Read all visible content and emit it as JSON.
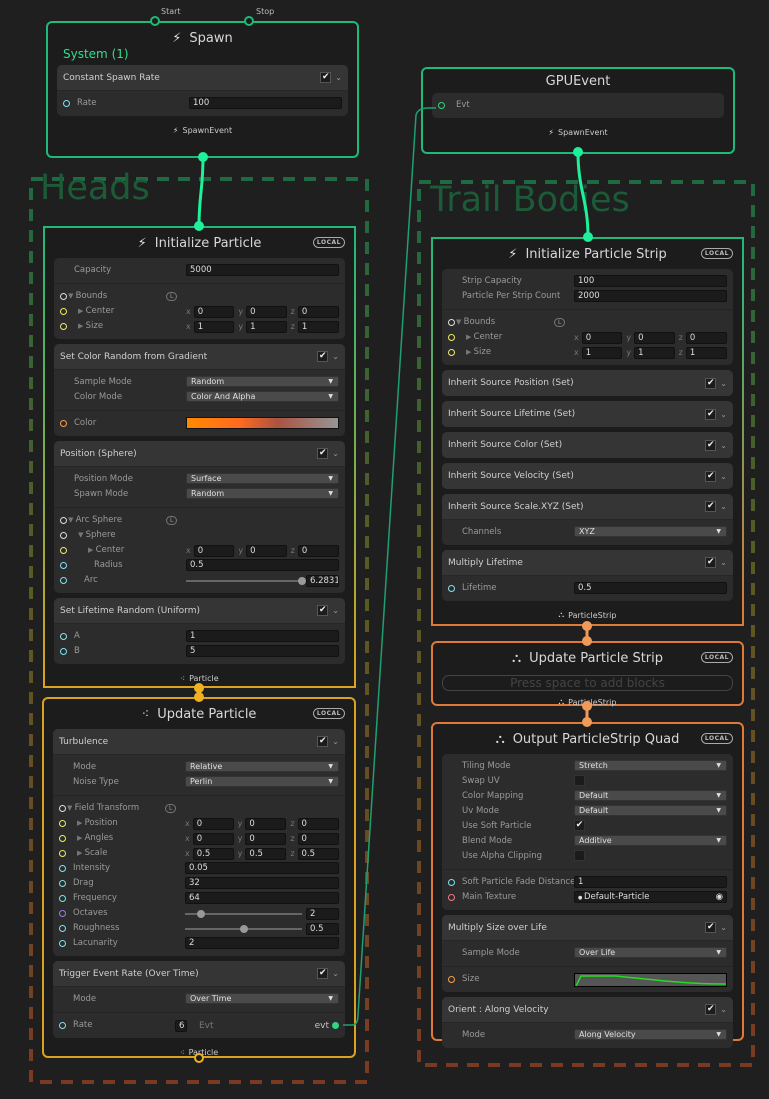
{
  "colors": {
    "spawn": "#1fb97a",
    "particle": "#d9a21f",
    "strip": "#dd7a3a",
    "float": "#7fe3f0",
    "vector": "#f0ea6a",
    "bounds": "#dddddd",
    "gradient": "#f4a050",
    "texture": "#f07a8a",
    "uint": "#9a7cf0",
    "event": "#2fd67f",
    "group_heads_top": "#1e6a42",
    "group_heads_bottom": "#7a3a22",
    "curve": "#22dd22"
  },
  "groups": [
    {
      "title": "Heads"
    },
    {
      "title": "Trail Bodies"
    }
  ],
  "spawn_ports": {
    "start": "Start",
    "stop": "Stop"
  },
  "nodes": {
    "spawn": {
      "title": "Spawn",
      "icon": "lightning-icon",
      "system": "System (1)",
      "blocks": [
        {
          "title": "Constant Spawn Rate",
          "enabled": true,
          "sections": [
            [
              {
                "type": "field",
                "label": "Rate",
                "value": "100",
                "port": "float"
              }
            ]
          ]
        }
      ],
      "footer": {
        "label": "SpawnEvent",
        "icon": "lightning-icon"
      }
    },
    "gpu_event": {
      "title": "GPUEvent",
      "blocks": [
        {
          "sections": [
            [
              {
                "type": "evt_in",
                "label": "Evt",
                "port": "event"
              }
            ]
          ]
        }
      ],
      "footer": {
        "label": "SpawnEvent",
        "icon": "lightning-icon"
      }
    },
    "init_particle": {
      "title": "Initialize Particle",
      "icon": "lightning-icon",
      "badge": "LOCAL",
      "blocks": [
        {
          "sections": [
            [
              {
                "type": "field",
                "label": "Capacity",
                "value": "5000"
              }
            ],
            [
              {
                "type": "group",
                "label": "Bounds",
                "port": "bounds",
                "space": "L"
              },
              {
                "type": "vec3",
                "label": "Center",
                "port": "vector",
                "indent": 1,
                "x": "0",
                "y": "0",
                "z": "0"
              },
              {
                "type": "vec3",
                "label": "Size",
                "port": "vector",
                "indent": 1,
                "x": "1",
                "y": "1",
                "z": "1"
              }
            ]
          ]
        },
        {
          "title": "Set Color Random from Gradient",
          "enabled": true,
          "sections": [
            [
              {
                "type": "dropdown",
                "label": "Sample Mode",
                "value": "Random"
              },
              {
                "type": "dropdown",
                "label": "Color Mode",
                "value": "Color And Alpha"
              }
            ],
            [
              {
                "type": "gradient",
                "label": "Color",
                "port": "gradient"
              }
            ]
          ]
        },
        {
          "title": "Position (Sphere)",
          "enabled": true,
          "sections": [
            [
              {
                "type": "dropdown",
                "label": "Position Mode",
                "value": "Surface"
              },
              {
                "type": "dropdown",
                "label": "Spawn Mode",
                "value": "Random"
              }
            ],
            [
              {
                "type": "group",
                "label": "Arc Sphere",
                "port": "bounds",
                "space": "L"
              },
              {
                "type": "group",
                "label": "Sphere",
                "port": "bounds",
                "indent": 1
              },
              {
                "type": "vec3",
                "label": "Center",
                "port": "vector",
                "indent": 2,
                "x": "0",
                "y": "0",
                "z": "0"
              },
              {
                "type": "field",
                "label": "Radius",
                "port": "float",
                "indent": 2,
                "value": "0.5"
              },
              {
                "type": "slider",
                "label": "Arc",
                "port": "float",
                "indent": 1,
                "value": "6.2831",
                "fraction": 1.0
              }
            ]
          ]
        },
        {
          "title": "Set Lifetime Random (Uniform)",
          "enabled": true,
          "sections": [
            [
              {
                "type": "field",
                "label": "A",
                "port": "float",
                "value": "1"
              },
              {
                "type": "field",
                "label": "B",
                "port": "float",
                "value": "5"
              }
            ]
          ]
        }
      ],
      "footer": {
        "label": "Particle",
        "icon": "particle-icon"
      }
    },
    "update_particle": {
      "title": "Update Particle",
      "icon": "particle-icon",
      "badge": "LOCAL",
      "blocks": [
        {
          "title": "Turbulence",
          "enabled": true,
          "sections": [
            [
              {
                "type": "dropdown",
                "label": "Mode",
                "value": "Relative"
              },
              {
                "type": "dropdown",
                "label": "Noise Type",
                "value": "Perlin"
              }
            ],
            [
              {
                "type": "group",
                "label": "Field Transform",
                "port": "bounds",
                "space": "L"
              },
              {
                "type": "vec3",
                "label": "Position",
                "port": "vector",
                "indent": 1,
                "x": "0",
                "y": "0",
                "z": "0"
              },
              {
                "type": "vec3",
                "label": "Angles",
                "port": "vector",
                "indent": 1,
                "x": "0",
                "y": "0",
                "z": "0"
              },
              {
                "type": "vec3",
                "label": "Scale",
                "port": "vector",
                "indent": 1,
                "x": "0.5",
                "y": "0.5",
                "z": "0.5"
              },
              {
                "type": "field",
                "label": "Intensity",
                "port": "float",
                "value": "0.05"
              },
              {
                "type": "field",
                "label": "Drag",
                "port": "float",
                "value": "32"
              },
              {
                "type": "field",
                "label": "Frequency",
                "port": "float",
                "value": "64"
              },
              {
                "type": "slider",
                "label": "Octaves",
                "port": "uint",
                "value": "2",
                "fraction": 0.14
              },
              {
                "type": "slider",
                "label": "Roughness",
                "port": "float",
                "value": "0.5",
                "fraction": 0.5
              },
              {
                "type": "field",
                "label": "Lacunarity",
                "port": "float",
                "value": "2"
              }
            ]
          ]
        },
        {
          "title": "Trigger Event Rate (Over Time)",
          "enabled": true,
          "sections": [
            [
              {
                "type": "dropdown",
                "label": "Mode",
                "value": "Over Time"
              }
            ],
            [
              {
                "type": "event_rate",
                "label": "Rate",
                "port": "float",
                "value": "6",
                "evt_label": "Evt",
                "out_label": "evt"
              }
            ]
          ]
        }
      ],
      "footer": {
        "label": "Particle",
        "icon": "particle-icon"
      }
    },
    "init_strip": {
      "title": "Initialize Particle Strip",
      "icon": "lightning-icon",
      "badge": "LOCAL",
      "blocks": [
        {
          "sections": [
            [
              {
                "type": "field",
                "label": "Strip Capacity",
                "value": "100"
              },
              {
                "type": "field",
                "label": "Particle Per Strip Count",
                "value": "2000"
              }
            ],
            [
              {
                "type": "group",
                "label": "Bounds",
                "port": "bounds",
                "space": "L"
              },
              {
                "type": "vec3",
                "label": "Center",
                "port": "vector",
                "indent": 1,
                "x": "0",
                "y": "0",
                "z": "0"
              },
              {
                "type": "vec3",
                "label": "Size",
                "port": "vector",
                "indent": 1,
                "x": "1",
                "y": "1",
                "z": "1"
              }
            ]
          ]
        },
        {
          "title": "Inherit Source Position (Set)",
          "enabled": true,
          "sections": []
        },
        {
          "title": "Inherit Source Lifetime (Set)",
          "enabled": true,
          "sections": []
        },
        {
          "title": "Inherit Source Color (Set)",
          "enabled": true,
          "sections": []
        },
        {
          "title": "Inherit Source Velocity (Set)",
          "enabled": true,
          "sections": []
        },
        {
          "title": "Inherit Source Scale.XYZ (Set)",
          "enabled": true,
          "sections": [
            [
              {
                "type": "dropdown",
                "label": "Channels",
                "value": "XYZ"
              }
            ]
          ]
        },
        {
          "title": "Multiply Lifetime",
          "enabled": true,
          "sections": [
            [
              {
                "type": "field",
                "label": "Lifetime",
                "port": "float",
                "value": "0.5"
              }
            ]
          ]
        }
      ],
      "footer": {
        "label": "ParticleStrip",
        "icon": "particle-strip-icon"
      }
    },
    "update_strip": {
      "title": "Update Particle Strip",
      "icon": "particle-strip-icon",
      "badge": "LOCAL",
      "empty": "Press space to add blocks",
      "blocks": [],
      "footer": {
        "label": "ParticleStrip",
        "icon": "particle-strip-icon"
      }
    },
    "output_strip": {
      "title": "Output ParticleStrip Quad",
      "icon": "particle-strip-icon",
      "badge": "LOCAL",
      "blocks": [
        {
          "sections": [
            [
              {
                "type": "dropdown",
                "label": "Tiling Mode",
                "value": "Stretch"
              },
              {
                "type": "checkbox",
                "label": "Swap UV",
                "checked": false
              },
              {
                "type": "dropdown",
                "label": "Color Mapping",
                "value": "Default"
              },
              {
                "type": "dropdown",
                "label": "Uv Mode",
                "value": "Default"
              },
              {
                "type": "checkbox",
                "label": "Use Soft Particle",
                "checked": true
              },
              {
                "type": "dropdown",
                "label": "Blend Mode",
                "value": "Additive"
              },
              {
                "type": "checkbox",
                "label": "Use Alpha Clipping",
                "checked": false
              }
            ],
            [
              {
                "type": "field",
                "label": "Soft Particle Fade Distance",
                "port": "float",
                "value": "1"
              },
              {
                "type": "texture",
                "label": "Main Texture",
                "port": "texture",
                "value": "Default-Particle"
              }
            ]
          ]
        },
        {
          "title": "Multiply Size over Life",
          "enabled": true,
          "sections": [
            [
              {
                "type": "dropdown",
                "label": "Sample Mode",
                "value": "Over Life"
              }
            ],
            [
              {
                "type": "curve",
                "label": "Size",
                "port": "gradient"
              }
            ]
          ]
        },
        {
          "title": "Orient : Along Velocity",
          "enabled": true,
          "sections": [
            [
              {
                "type": "dropdown",
                "label": "Mode",
                "value": "Along Velocity"
              }
            ]
          ]
        }
      ]
    }
  }
}
